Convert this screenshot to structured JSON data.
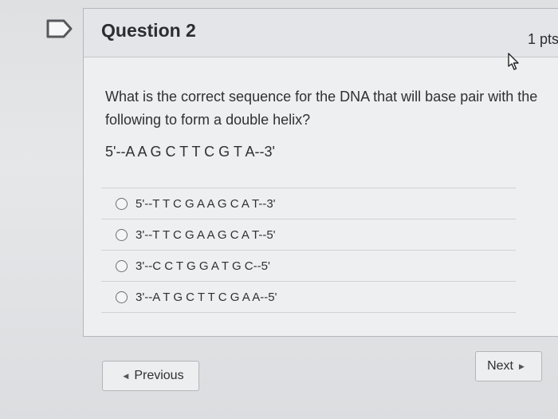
{
  "question": {
    "title": "Question 2",
    "points": "1 pts",
    "prompt": "What is the correct sequence for the DNA that will base pair with the following to form a double helix?",
    "sequence": "5'--A A G C T T C G T A--3'"
  },
  "answers": [
    {
      "label": "5'--T T C G A A G C A T--3'",
      "selected": false
    },
    {
      "label": "3'--T T C G A A G C A T--5'",
      "selected": false
    },
    {
      "label": "3'--C C T G G A T G C--5'",
      "selected": false
    },
    {
      "label": "3'--A T G C T T C G A A--5'",
      "selected": false
    }
  ],
  "nav": {
    "previous": "Previous",
    "next": "Next"
  },
  "icons": {
    "flag": "flag-bookmark-icon",
    "cursor": "mouse-pointer-icon",
    "prev_arrow": "left-triangle-icon",
    "next_arrow": "right-triangle-icon"
  }
}
